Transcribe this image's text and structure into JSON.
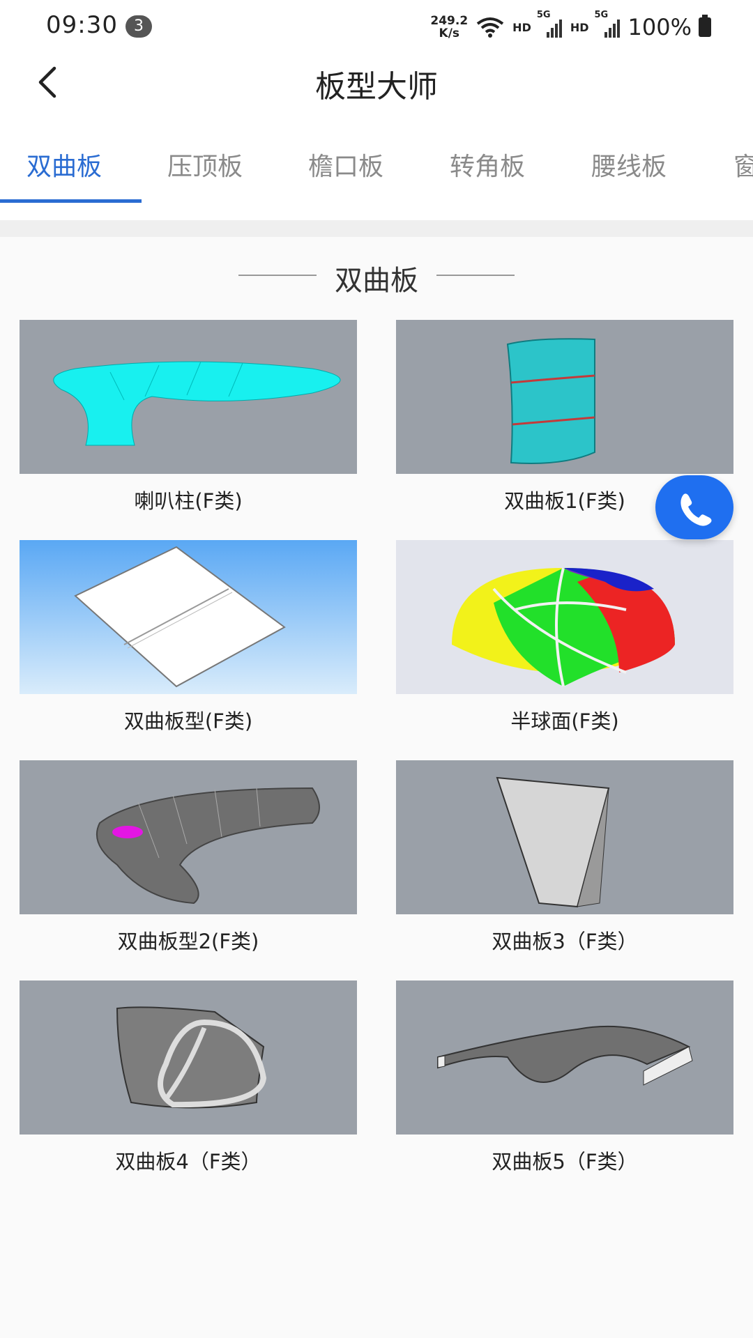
{
  "status_bar": {
    "time": "09:30",
    "notification_count": "3",
    "net_speed_value": "249.2",
    "net_speed_unit": "K/s",
    "hd1": "HD",
    "hd2": "HD",
    "sig1": "5G",
    "sig2": "5G",
    "battery": "100%"
  },
  "header": {
    "title": "板型大师"
  },
  "tabs": [
    {
      "label": "双曲板",
      "active": true
    },
    {
      "label": "压顶板"
    },
    {
      "label": "檐口板"
    },
    {
      "label": "转角板"
    },
    {
      "label": "腰线板"
    },
    {
      "label": "窗"
    }
  ],
  "section": {
    "title": "双曲板"
  },
  "items": [
    {
      "label": "喇叭柱(F类)"
    },
    {
      "label": "双曲板1(F类)"
    },
    {
      "label": "双曲板型(F类)"
    },
    {
      "label": "半球面(F类)"
    },
    {
      "label": "双曲板型2(F类)"
    },
    {
      "label": "双曲板3（F类）"
    },
    {
      "label": "双曲板4（F类）"
    },
    {
      "label": "双曲板5（F类）"
    }
  ],
  "colors": {
    "accent": "#2a6cd2",
    "fab": "#1f6ff0"
  }
}
